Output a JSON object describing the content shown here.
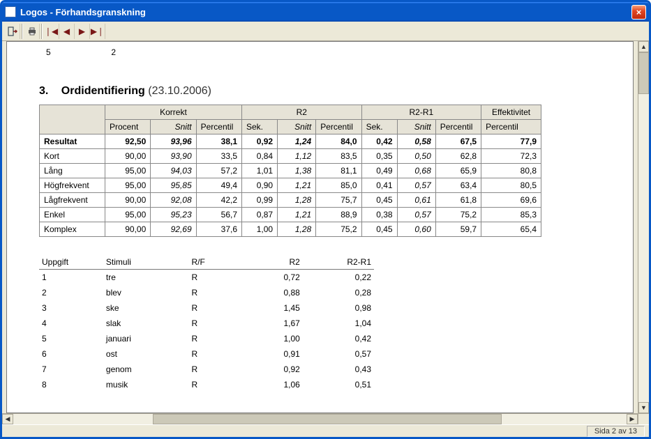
{
  "window": {
    "title": "Logos - Förhandsgranskning",
    "close": "×"
  },
  "status": {
    "page": "Sida 2 av 13"
  },
  "section": {
    "num": "3.",
    "name": "Ordidentifiering",
    "date": "(23.10.2006)"
  },
  "top_fragment": {
    "col1": "5",
    "col2": "2"
  },
  "headers": {
    "korrekt": "Korrekt",
    "r2": "R2",
    "r2r1": "R2-R1",
    "eff": "Effektivitet",
    "procent": "Procent",
    "snitt": "Snitt",
    "percentil": "Percentil",
    "sek": "Sek."
  },
  "result_rows": [
    {
      "label": "Resultat",
      "bold": true,
      "procent": "92,50",
      "snitt1": "93,96",
      "pc1": "38,1",
      "sek1": "0,92",
      "snitt2": "1,24",
      "pc2": "84,0",
      "sek2": "0,42",
      "snitt3": "0,58",
      "pc3": "67,5",
      "eff": "77,9"
    },
    {
      "label": "Kort",
      "procent": "90,00",
      "snitt1": "93,90",
      "pc1": "33,5",
      "sek1": "0,84",
      "snitt2": "1,12",
      "pc2": "83,5",
      "sek2": "0,35",
      "snitt3": "0,50",
      "pc3": "62,8",
      "eff": "72,3"
    },
    {
      "label": "Lång",
      "procent": "95,00",
      "snitt1": "94,03",
      "pc1": "57,2",
      "sek1": "1,01",
      "snitt2": "1,38",
      "pc2": "81,1",
      "sek2": "0,49",
      "snitt3": "0,68",
      "pc3": "65,9",
      "eff": "80,8"
    },
    {
      "label": "Högfrekvent",
      "procent": "95,00",
      "snitt1": "95,85",
      "pc1": "49,4",
      "sek1": "0,90",
      "snitt2": "1,21",
      "pc2": "85,0",
      "sek2": "0,41",
      "snitt3": "0,57",
      "pc3": "63,4",
      "eff": "80,5"
    },
    {
      "label": "Lågfrekvent",
      "procent": "90,00",
      "snitt1": "92,08",
      "pc1": "42,2",
      "sek1": "0,99",
      "snitt2": "1,28",
      "pc2": "75,7",
      "sek2": "0,45",
      "snitt3": "0,61",
      "pc3": "61,8",
      "eff": "69,6"
    },
    {
      "label": "Enkel",
      "procent": "95,00",
      "snitt1": "95,23",
      "pc1": "56,7",
      "sek1": "0,87",
      "snitt2": "1,21",
      "pc2": "88,9",
      "sek2": "0,38",
      "snitt3": "0,57",
      "pc3": "75,2",
      "eff": "85,3"
    },
    {
      "label": "Komplex",
      "procent": "90,00",
      "snitt1": "92,69",
      "pc1": "37,6",
      "sek1": "1,00",
      "snitt2": "1,28",
      "pc2": "75,2",
      "sek2": "0,45",
      "snitt3": "0,60",
      "pc3": "59,7",
      "eff": "65,4"
    }
  ],
  "uppgift_headers": {
    "uppgift": "Uppgift",
    "stimuli": "Stimuli",
    "rf": "R/F",
    "r2": "R2",
    "r2r1": "R2-R1"
  },
  "uppgift_rows": [
    {
      "n": "1",
      "stimuli": "tre",
      "rf": "R",
      "r2": "0,72",
      "r2r1": "0,22"
    },
    {
      "n": "2",
      "stimuli": "blev",
      "rf": "R",
      "r2": "0,88",
      "r2r1": "0,28"
    },
    {
      "n": "3",
      "stimuli": "ske",
      "rf": "R",
      "r2": "1,45",
      "r2r1": "0,98"
    },
    {
      "n": "4",
      "stimuli": "slak",
      "rf": "R",
      "r2": "1,67",
      "r2r1": "1,04"
    },
    {
      "n": "5",
      "stimuli": "januari",
      "rf": "R",
      "r2": "1,00",
      "r2r1": "0,42"
    },
    {
      "n": "6",
      "stimuli": "ost",
      "rf": "R",
      "r2": "0,91",
      "r2r1": "0,57"
    },
    {
      "n": "7",
      "stimuli": "genom",
      "rf": "R",
      "r2": "0,92",
      "r2r1": "0,43"
    },
    {
      "n": "8",
      "stimuli": "musik",
      "rf": "R",
      "r2": "1,06",
      "r2r1": "0,51"
    }
  ]
}
